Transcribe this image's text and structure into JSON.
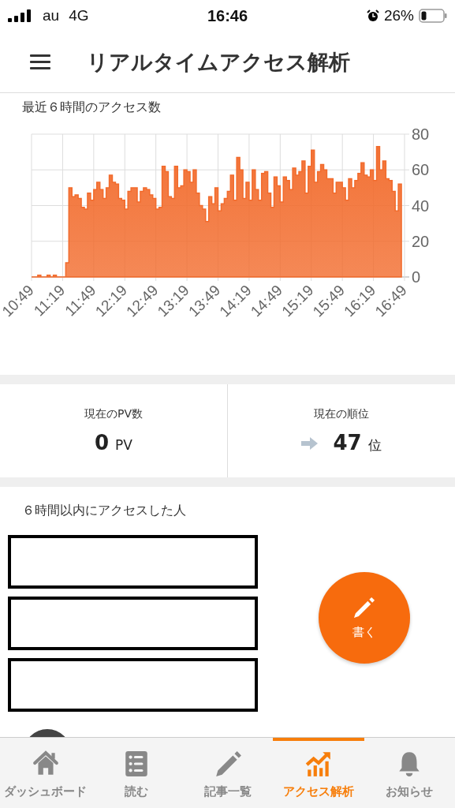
{
  "status_bar": {
    "carrier": "au",
    "network": "4G",
    "time": "16:46",
    "battery": "26%"
  },
  "header": {
    "title": "リアルタイムアクセス解析"
  },
  "access_chart": {
    "title": "最近６時間のアクセス数",
    "chart_data": {
      "type": "area",
      "ylim": [
        0,
        80
      ],
      "yticks": [
        0,
        20,
        40,
        60,
        80
      ],
      "grid": true,
      "categories": [
        "10:49",
        null,
        null,
        null,
        null,
        null,
        null,
        null,
        null,
        null,
        "11:19",
        null,
        null,
        null,
        null,
        null,
        null,
        null,
        null,
        null,
        "11:49",
        null,
        null,
        null,
        null,
        null,
        null,
        null,
        null,
        null,
        "12:19",
        null,
        null,
        null,
        null,
        null,
        null,
        null,
        null,
        null,
        "12:49",
        null,
        null,
        null,
        null,
        null,
        null,
        null,
        null,
        null,
        "13:19",
        null,
        null,
        null,
        null,
        null,
        null,
        null,
        null,
        null,
        "13:49",
        null,
        null,
        null,
        null,
        null,
        null,
        null,
        null,
        null,
        "14:19",
        null,
        null,
        null,
        null,
        null,
        null,
        null,
        null,
        null,
        "14:49",
        null,
        null,
        null,
        null,
        null,
        null,
        null,
        null,
        null,
        "15:19",
        null,
        null,
        null,
        null,
        null,
        null,
        null,
        null,
        null,
        "15:49",
        null,
        null,
        null,
        null,
        null,
        null,
        null,
        null,
        null,
        "16:19",
        null,
        null,
        null,
        null,
        null,
        null,
        null,
        null,
        null,
        "16:49"
      ],
      "series": [
        {
          "color": "#f26b2c",
          "values": [
            0,
            0,
            1,
            0,
            0,
            1,
            0,
            1,
            0,
            0,
            0,
            8,
            50,
            45,
            46,
            44,
            39,
            38,
            47,
            43,
            49,
            53,
            49,
            44,
            50,
            57,
            53,
            52,
            44,
            43,
            38,
            48,
            50,
            50,
            42,
            48,
            50,
            49,
            46,
            44,
            38,
            39,
            62,
            59,
            45,
            44,
            62,
            50,
            51,
            60,
            59,
            53,
            60,
            47,
            40,
            38,
            31,
            45,
            41,
            50,
            37,
            41,
            44,
            48,
            57,
            43,
            67,
            60,
            44,
            53,
            43,
            60,
            49,
            43,
            58,
            59,
            47,
            39,
            56,
            51,
            42,
            56,
            54,
            49,
            61,
            57,
            59,
            65,
            47,
            62,
            71,
            53,
            59,
            63,
            60,
            55,
            55,
            47,
            53,
            53,
            50,
            43,
            55,
            50,
            54,
            58,
            64,
            57,
            56,
            60,
            54,
            73,
            60,
            65,
            55,
            54,
            48,
            37,
            52,
            52,
            null
          ]
        }
      ]
    }
  },
  "stats": [
    {
      "kind": "count",
      "label": "現在のPV数",
      "value": "0",
      "unit": "PV"
    },
    {
      "kind": "rank",
      "label": "現在の順位",
      "value": "47",
      "unit": "位"
    }
  ],
  "visitors": {
    "title": "６時間以内にアクセスした人",
    "entries": [
      {
        "kind": "redacted"
      },
      {
        "kind": "redacted"
      },
      {
        "kind": "redacted"
      }
    ]
  },
  "write_button": {
    "label": "書く"
  },
  "tabs": [
    {
      "kind": "home",
      "label": "ダッシュボード",
      "selected": false
    },
    {
      "kind": "list",
      "label": "読む",
      "selected": false
    },
    {
      "kind": "pencil",
      "label": "記事一覧",
      "selected": false
    },
    {
      "kind": "chart",
      "label": "アクセス解析",
      "selected": true
    },
    {
      "kind": "bell",
      "label": "お知らせ",
      "selected": false
    }
  ]
}
